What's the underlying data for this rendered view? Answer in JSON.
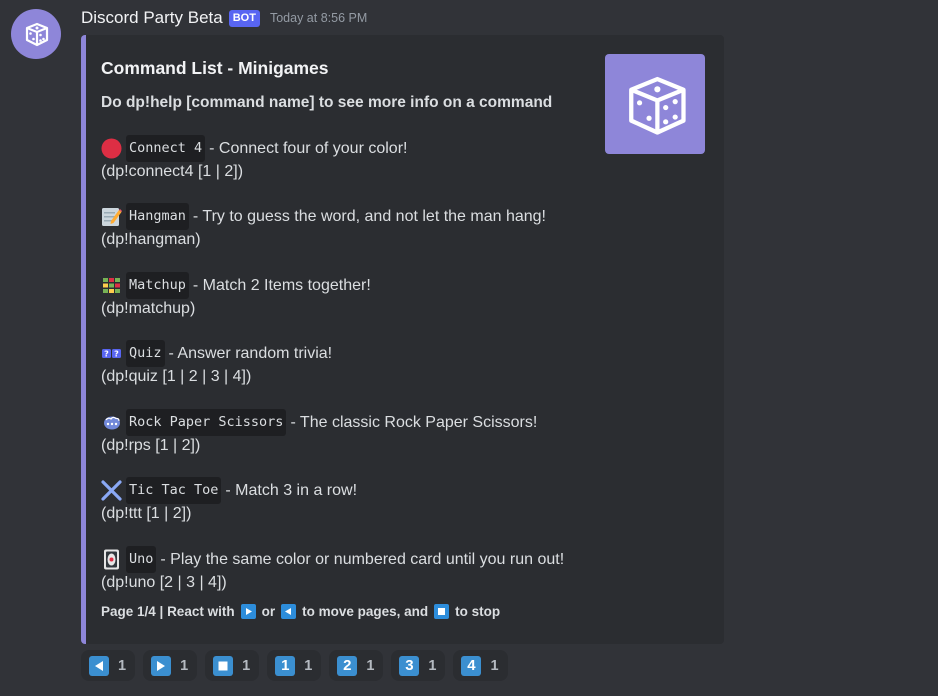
{
  "message": {
    "username": "Discord Party Beta",
    "bot_tag": "BOT",
    "timestamp": "Today at 8:56 PM"
  },
  "embed": {
    "accent_color": "#8e86d9",
    "title": "Command List - Minigames",
    "subtitle": "Do dp!help [command name] to see more info on a command",
    "commands": [
      {
        "icon": "red-circle-icon",
        "name": "Connect 4",
        "description": "- Connect four of your color!",
        "usage": "(dp!connect4 [1 | 2])"
      },
      {
        "icon": "memo-icon",
        "name": "Hangman",
        "description": "- Try to guess the word, and not let the man hang!",
        "usage": "(dp!hangman)"
      },
      {
        "icon": "grid-icon",
        "name": "Matchup",
        "description": "- Match 2 Items together!",
        "usage": "(dp!matchup)"
      },
      {
        "icon": "question-marks-icon",
        "name": "Quiz",
        "description": "- Answer random trivia!",
        "usage": "(dp!quiz [1 | 2 | 3 | 4])"
      },
      {
        "icon": "fist-icon",
        "name": "Rock Paper Scissors",
        "description": "- The classic Rock Paper Scissors!",
        "usage": "(dp!rps [1 | 2])"
      },
      {
        "icon": "cross-icon",
        "name": "Tic Tac Toe",
        "description": "- Match 3 in a row!",
        "usage": "(dp!ttt [1 | 2])"
      },
      {
        "icon": "playing-card-icon",
        "name": "Uno",
        "description": "- Play the same color or numbered card until you run out!",
        "usage": "(dp!uno [2 | 3 | 4])"
      }
    ],
    "footer": {
      "part1": "Page 1/4 | React with",
      "part2": "or",
      "part3": "to move pages, and",
      "part4": "to stop"
    }
  },
  "reactions": [
    {
      "icon": "arrow-left-icon",
      "count": "1"
    },
    {
      "icon": "arrow-right-icon",
      "count": "1"
    },
    {
      "icon": "stop-icon",
      "count": "1"
    },
    {
      "label": "1",
      "count": "1"
    },
    {
      "label": "2",
      "count": "1"
    },
    {
      "label": "3",
      "count": "1"
    },
    {
      "label": "4",
      "count": "1"
    }
  ]
}
